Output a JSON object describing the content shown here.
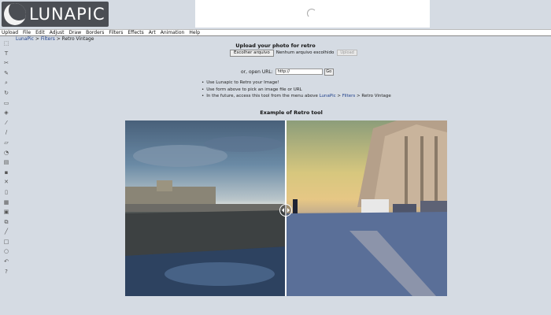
{
  "header": {
    "logo_text": "LUNAPIC"
  },
  "menu": [
    "Upload",
    "File",
    "Edit",
    "Adjust",
    "Draw",
    "Borders",
    "Filters",
    "Effects",
    "Art",
    "Animation",
    "Help"
  ],
  "breadcrumb": {
    "home": "LunaPic",
    "sep1": " > ",
    "filters": "Filters",
    "sep2": " > ",
    "current": "Retro Vintage"
  },
  "toolbar_icons": [
    "select-icon",
    "text-icon",
    "scissors-icon",
    "pencil-icon",
    "zoom-icon",
    "rotate-icon",
    "crop-icon",
    "paint-bucket-icon",
    "eyedropper-icon",
    "brush-icon",
    "eraser-icon",
    "spray-icon",
    "layers-icon",
    "save-icon",
    "close-icon",
    "new-icon",
    "print-icon",
    "stack-icon",
    "copy-icon",
    "line-icon",
    "rectangle-icon",
    "circle-icon",
    "undo-icon",
    "help-icon"
  ],
  "upload": {
    "title": "Upload your photo for retro",
    "choose_label": "Escolher arquivo",
    "no_file": "Nenhum arquivo escolhido",
    "upload_button": "Upload",
    "url_label": "or, open URL:",
    "url_value": "http://",
    "go_label": "Go"
  },
  "tips": {
    "tip1": "Use Lunapic to Retro your Image!",
    "tip2": "Use form above to pick an image file or URL",
    "tip3_prefix": "In the future, access this tool from the menu above ",
    "tip3_link1": "LunaPic",
    "tip3_sep1": " > ",
    "tip3_link2": "Filters",
    "tip3_sep2": " > ",
    "tip3_end": "Retro Vintage"
  },
  "example": {
    "title": "Example of Retro tool"
  }
}
